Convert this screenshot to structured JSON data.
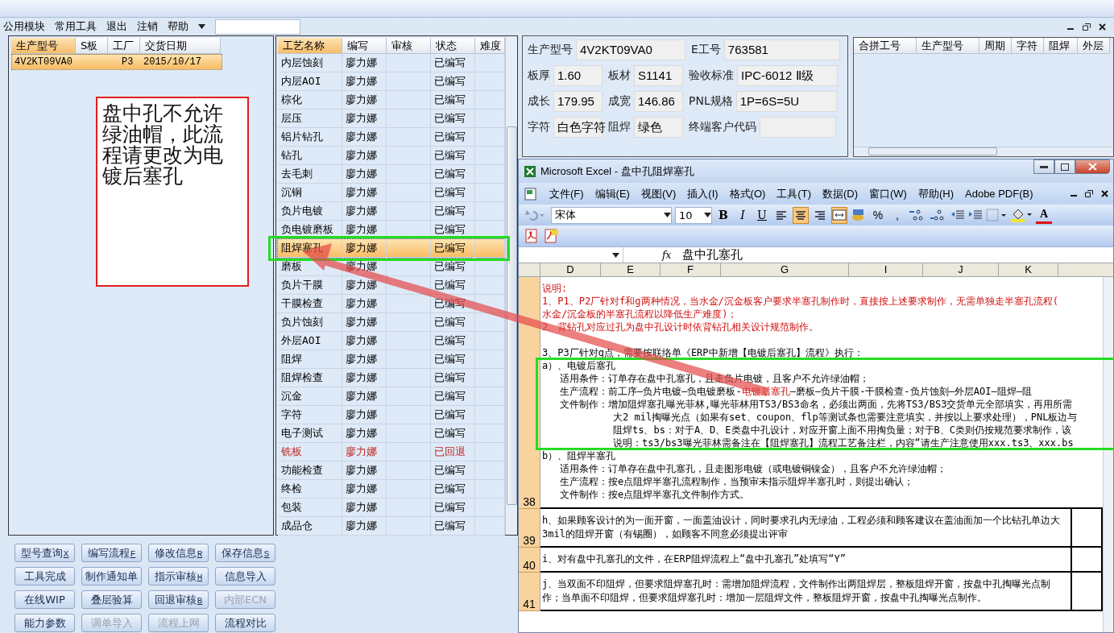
{
  "menu": {
    "items": [
      "公用模块",
      "常用工具",
      "退出",
      "注销",
      "帮助"
    ]
  },
  "orders": {
    "columns": [
      {
        "label": "生产型号",
        "sorted": true
      },
      {
        "label": "S板",
        "sorted": false
      },
      {
        "label": "工厂",
        "sorted": false
      },
      {
        "label": "交货日期",
        "sorted": false
      }
    ],
    "rows": [
      {
        "model": "4V2KT09VA0",
        "factory": "P3",
        "date": "2015/10/17",
        "selected": true
      }
    ]
  },
  "annotation": "盘中孔不允许绿油帽，此流程请更改为电镀后塞孔",
  "buttons": [
    {
      "label": "型号查询",
      "shortcut": "X",
      "disabled": false
    },
    {
      "label": "编写流程",
      "shortcut": "F",
      "disabled": false
    },
    {
      "label": "修改信息",
      "shortcut": "R",
      "disabled": false
    },
    {
      "label": "保存信息",
      "shortcut": "S",
      "disabled": false
    },
    {
      "label": "工具完成",
      "disabled": false
    },
    {
      "label": "制作通知单",
      "disabled": false
    },
    {
      "label": "指示审核",
      "shortcut": "H",
      "disabled": false
    },
    {
      "label": "信息导入",
      "disabled": false
    },
    {
      "label": "在线WIP",
      "disabled": false
    },
    {
      "label": "叠层验算",
      "disabled": false
    },
    {
      "label": "回退审核",
      "shortcut": "B",
      "disabled": false
    },
    {
      "label": "内部ECN",
      "disabled": true
    },
    {
      "label": "能力参数",
      "disabled": false
    },
    {
      "label": "调单导入",
      "disabled": true
    },
    {
      "label": "流程上网",
      "disabled": true
    },
    {
      "label": "流程对比",
      "disabled": false
    }
  ],
  "process": {
    "columns": [
      {
        "label": "工艺名称",
        "sorted": true
      },
      {
        "label": "编写",
        "sorted": false
      },
      {
        "label": "审核",
        "sorted": false
      },
      {
        "label": "状态",
        "sorted": false
      },
      {
        "label": "难度",
        "sorted": false
      }
    ],
    "rows": [
      {
        "name": "内层蚀刻",
        "writer": "廖力娜",
        "status": "已编写",
        "selected": false,
        "returned": false
      },
      {
        "name": "内层AOI",
        "writer": "廖力娜",
        "status": "已编写",
        "selected": false,
        "returned": false
      },
      {
        "name": "棕化",
        "writer": "廖力娜",
        "status": "已编写",
        "selected": false,
        "returned": false
      },
      {
        "name": "层压",
        "writer": "廖力娜",
        "status": "已编写",
        "selected": false,
        "returned": false
      },
      {
        "name": "铝片钻孔",
        "writer": "廖力娜",
        "status": "已编写",
        "selected": false,
        "returned": false
      },
      {
        "name": "钻孔",
        "writer": "廖力娜",
        "status": "已编写",
        "selected": false,
        "returned": false
      },
      {
        "name": "去毛刺",
        "writer": "廖力娜",
        "status": "已编写",
        "selected": false,
        "returned": false
      },
      {
        "name": "沉铜",
        "writer": "廖力娜",
        "status": "已编写",
        "selected": false,
        "returned": false
      },
      {
        "name": "负片电镀",
        "writer": "廖力娜",
        "status": "已编写",
        "selected": false,
        "returned": false
      },
      {
        "name": "负电镀磨板",
        "writer": "廖力娜",
        "status": "已编写",
        "selected": false,
        "returned": false
      },
      {
        "name": "阻焊塞孔",
        "writer": "廖力娜",
        "status": "已编写",
        "selected": true,
        "returned": false
      },
      {
        "name": "磨板",
        "writer": "廖力娜",
        "status": "已编写",
        "selected": false,
        "returned": false
      },
      {
        "name": "负片干膜",
        "writer": "廖力娜",
        "status": "已编写",
        "selected": false,
        "returned": false
      },
      {
        "name": "干膜检查",
        "writer": "廖力娜",
        "status": "已编写",
        "selected": false,
        "returned": false
      },
      {
        "name": "负片蚀刻",
        "writer": "廖力娜",
        "status": "已编写",
        "selected": false,
        "returned": false
      },
      {
        "name": "外层AOI",
        "writer": "廖力娜",
        "status": "已编写",
        "selected": false,
        "returned": false
      },
      {
        "name": "阻焊",
        "writer": "廖力娜",
        "status": "已编写",
        "selected": false,
        "returned": false
      },
      {
        "name": "阻焊检查",
        "writer": "廖力娜",
        "status": "已编写",
        "selected": false,
        "returned": false
      },
      {
        "name": "沉金",
        "writer": "廖力娜",
        "status": "已编写",
        "selected": false,
        "returned": false
      },
      {
        "name": "字符",
        "writer": "廖力娜",
        "status": "已编写",
        "selected": false,
        "returned": false
      },
      {
        "name": "电子测试",
        "writer": "廖力娜",
        "status": "已编写",
        "selected": false,
        "returned": false
      },
      {
        "name": "铣板",
        "writer": "廖力娜",
        "status": "已回退",
        "selected": false,
        "returned": true
      },
      {
        "name": "功能检查",
        "writer": "廖力娜",
        "status": "已编写",
        "selected": false,
        "returned": false
      },
      {
        "name": "终检",
        "writer": "廖力娜",
        "status": "已编写",
        "selected": false,
        "returned": false
      },
      {
        "name": "包装",
        "writer": "廖力娜",
        "status": "已编写",
        "selected": false,
        "returned": false
      },
      {
        "name": "成品仓",
        "writer": "廖力娜",
        "status": "已编写",
        "selected": false,
        "returned": false
      }
    ]
  },
  "form": [
    {
      "fields": [
        {
          "label": "生产型号",
          "value": "4V2KT09VA0"
        },
        {
          "label": "E工号",
          "value": "763581"
        }
      ]
    },
    {
      "fields": [
        {
          "label": "板厚",
          "value": "1.60"
        },
        {
          "label": "板材",
          "value": "S1141"
        },
        {
          "label": "验收标准",
          "value": "IPC-6012 Ⅱ级"
        }
      ]
    },
    {
      "fields": [
        {
          "label": "成长",
          "value": "179.95"
        },
        {
          "label": "成宽",
          "value": "146.86"
        },
        {
          "label": "PNL规格",
          "value": "1P=6S=5U"
        }
      ]
    },
    {
      "fields": [
        {
          "label": "字符",
          "value": "白色字符"
        },
        {
          "label": "阻焊",
          "value": "绿色"
        },
        {
          "label": "终端客户代码"
        }
      ]
    }
  ],
  "batch_table": {
    "columns": [
      "合拼工号",
      "生产型号",
      "周期",
      "字符",
      "阻焊",
      "外层"
    ]
  },
  "excel": {
    "title": "Microsoft Excel - 盘中孔阻焊塞孔",
    "menu": [
      "文件(F)",
      "编辑(E)",
      "视图(V)",
      "插入(I)",
      "格式(O)",
      "工具(T)",
      "数据(D)",
      "窗口(W)",
      "帮助(H)",
      "Adobe PDF(B)"
    ],
    "toolbar": {
      "font": "宋体",
      "size": "10",
      "styles": [
        "B",
        "I",
        "U"
      ],
      "align": [
        {
          "selected": false
        },
        {
          "selected": true
        },
        {
          "selected": false
        }
      ],
      "merge": {
        "selected": true
      },
      "percent": "%",
      "comma": ",",
      "font_color": "A"
    },
    "formula_label": "fx",
    "formula": "盘中孔塞孔",
    "columns": [
      "D",
      "E",
      "F",
      "G",
      "I",
      "J",
      "K"
    ],
    "rows": [
      {
        "number": "38",
        "lines": [
          {
            "kind": "note",
            "text": "说明:"
          },
          {
            "kind": "note",
            "text": "1、P1、P2厂针对f和g两种情况，当水金/沉金板客户要求半塞孔制作时，直接按上述要求制作，无需单独走半塞孔流程("
          },
          {
            "kind": "note",
            "text": "水金/沉金板的半塞孔流程以降低生产难度)；"
          },
          {
            "kind": "note",
            "text": "2、背钻孔对应过孔为盘中孔设计时依背钻孔相关设计规范制作。"
          },
          {
            "kind": "section",
            "text": "3、P3厂针对g点，需要按联络单《ERP中新增【电镀后塞孔】流程》执行："
          },
          {
            "kind": "heading",
            "text": "a）、电镀后塞孔"
          },
          {
            "kind": "item",
            "text": "适用条件：订单存在盘中孔塞孔，且走负片电镀，且客户不允许绿油帽；"
          },
          {
            "kind": "item",
            "text": "生产流程：前工序—负片电镀—负电镀磨板-**电镀后塞孔**—磨板—负片干膜-干膜检查-负片蚀刻—外层AOI—阻焊—阻"
          },
          {
            "kind": "item",
            "text": "文件制作：增加阻焊塞孔曝光菲林,曝光菲林用TS3/BS3命名，必须出两面，先将TS3/BS3交货单元全部填实，再用所需"
          },
          {
            "kind": "continued",
            "text": "大2 mil掏曝光点（如果有set、coupon、flp等测试条也需要注意填实，并按以上要求处理），PNL板边与"
          },
          {
            "kind": "continued",
            "text": "阻焊ts、bs：对于A、D、E类盘中孔设计，对应开窗上面不用掏负量；对于B、C类则仍按规范要求制作，该"
          },
          {
            "kind": "continued",
            "text": "说明：ts3/bs3曝光菲林需备注在【阻焊塞孔】流程工艺备注栏，内容“请生产注意使用xxx.ts3、xxx.bs"
          },
          {
            "kind": "heading",
            "text": "b）、阻焊半塞孔"
          },
          {
            "kind": "item",
            "text": "适用条件：订单存在盘中孔塞孔，且走图形电镀（或电镀铜镍金），且客户不允许绿油帽；"
          },
          {
            "kind": "item",
            "text": "生产流程：按e点阻焊半塞孔流程制作，当预审未指示阻焊半塞孔时，则提出确认；"
          },
          {
            "kind": "item",
            "text": "文件制作：按e点阻焊半塞孔文件制作方式。"
          }
        ]
      },
      {
        "number": "39",
        "lines": [
          {
            "kind": "paragraph",
            "text": "h、如果顾客设计的为一面开窗，一面盖油设计，同时要求孔内无绿油，工程必须和顾客建议在盖油面加一个比钻孔单边大3mil的阻焊开窗（有锡圈），如顾客不同意必须提出评审"
          }
        ]
      },
      {
        "number": "40",
        "lines": [
          {
            "kind": "paragraph",
            "text": "i、对有盘中孔塞孔的文件，在ERP阻焊流程上“盘中孔塞孔”处填写“Y”"
          }
        ]
      },
      {
        "number": "41",
        "lines": [
          {
            "kind": "paragraph",
            "text": "j、当双面不印阻焊，但要求阻焊塞孔时：需增加阻焊流程，文件制作出两阻焊层，整板阻焊开窗，按盘中孔掏曝光点制作；当单面不印阻焊，但要求阻焊塞孔时：增加一层阻焊文件，整板阻焊开窗，按盘中孔掏曝光点制作。"
          }
        ]
      }
    ]
  }
}
